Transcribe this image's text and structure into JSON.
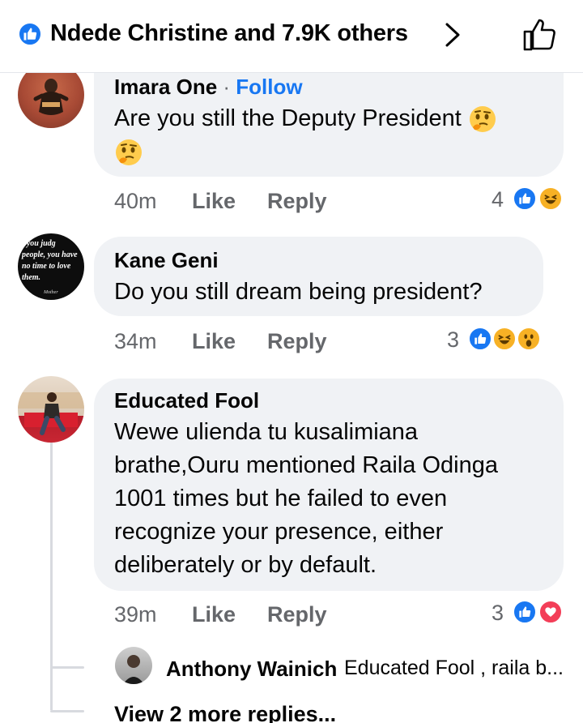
{
  "header": {
    "reactions_summary": "Ndede Christine and 7.9K others"
  },
  "comments": [
    {
      "author": "Imara One",
      "follow_label": "Follow",
      "text": "Are you still the Deputy President",
      "time": "40m",
      "like_label": "Like",
      "reply_label": "Reply",
      "reaction_count": "4",
      "reactions": [
        "like",
        "haha"
      ]
    },
    {
      "author": "Kane Geni",
      "avatar_text": "f you judg people, you have no time to love them.",
      "avatar_attribution": "Mother",
      "text": "Do you still dream being president?",
      "time": "34m",
      "like_label": "Like",
      "reply_label": "Reply",
      "reaction_count": "3",
      "reactions": [
        "like",
        "haha",
        "wow"
      ]
    },
    {
      "author": "Educated Fool",
      "text_lines": [
        "Wewe ulienda tu kusalimiana",
        "brathe,Ouru mentioned Raila Odinga",
        "1001 times but he failed to even",
        "recognize your presence, either",
        "deliberately or by default."
      ],
      "time": "39m",
      "like_label": "Like",
      "reply_label": "Reply",
      "reaction_count": "3",
      "reactions": [
        "like",
        "love"
      ],
      "reply_preview": {
        "author": "Anthony Wainich",
        "text": "Educated Fool , raila b..."
      },
      "more_replies": "View 2 more replies..."
    }
  ],
  "colors": {
    "facebook_blue": "#1877f2",
    "bubble_bg": "#f0f2f5",
    "meta_gray": "#65676b",
    "haha_yellow": "#f7b125",
    "love_red": "#f33e58"
  }
}
